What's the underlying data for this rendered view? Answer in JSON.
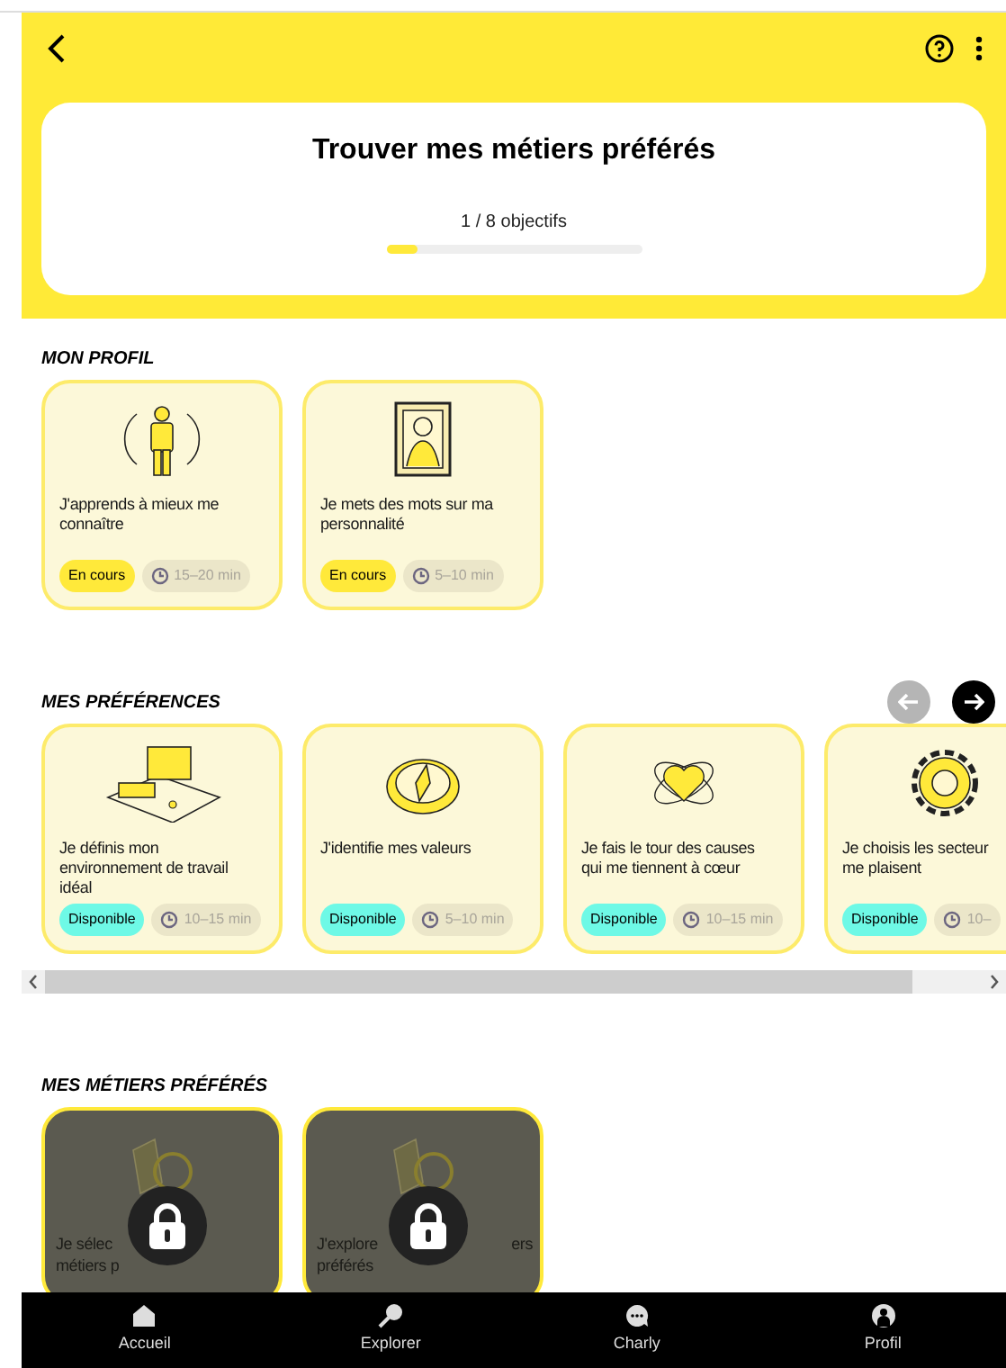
{
  "header": {
    "title": "Trouver mes métiers préférés",
    "progress_text": "1 / 8 objectifs",
    "level": 0.125
  },
  "sections": [
    {
      "title": "MON PROFIL",
      "cards": [
        {
          "kind": "person",
          "lines": [
            "J'apprends à mieux me",
            "connaître"
          ],
          "status": {
            "label": "En cours",
            "kind": "in_progress"
          },
          "duration": "15–20 min",
          "locked": false
        },
        {
          "kind": "portrait",
          "lines": [
            "Je mets des mots sur ma",
            "personnalité"
          ],
          "status": {
            "label": "En cours",
            "kind": "in_progress"
          },
          "duration": "5–10 min",
          "locked": false
        }
      ]
    },
    {
      "title": "MES PRÉFÉRENCES",
      "nav": [
        {
          "kind": "prev",
          "disabled": true
        },
        {
          "kind": "next",
          "disabled": false
        }
      ],
      "scrollbar": true,
      "cards": [
        {
          "kind": "computer",
          "lines": [
            "Je définis mon",
            "environnement de travail",
            "idéal"
          ],
          "status": {
            "label": "Disponible",
            "kind": "available"
          },
          "duration": "10–15 min",
          "locked": false
        },
        {
          "kind": "compass",
          "lines": [
            "J'identifie mes valeurs"
          ],
          "status": {
            "label": "Disponible",
            "kind": "available"
          },
          "duration": "5–10 min",
          "locked": false
        },
        {
          "kind": "heart",
          "lines": [
            "Je fais le tour des causes",
            "qui me tiennent à cœur"
          ],
          "status": {
            "label": "Disponible",
            "kind": "available"
          },
          "duration": "10–15 min",
          "locked": false
        },
        {
          "kind": "gear",
          "lines": [
            "Je choisis les secteur",
            "me plaisent"
          ],
          "status": {
            "label": "Disponible",
            "kind": "available"
          },
          "duration": "10–",
          "locked": false
        }
      ]
    },
    {
      "title": "MES MÉTIERS PRÉFÉRÉS",
      "cards": [
        {
          "kind": "folder",
          "lines": [
            {
              "left": "Je sélec"
            },
            {
              "left": "métiers p"
            }
          ],
          "locked": true
        },
        {
          "kind": "folder",
          "lines": [
            {
              "left": "J'explore",
              "right": "ers"
            },
            {
              "left": "préférés"
            }
          ],
          "locked": true
        }
      ]
    }
  ],
  "bottom_nav": [
    {
      "kind": "home",
      "label": "Accueil"
    },
    {
      "kind": "search",
      "label": "Explorer"
    },
    {
      "kind": "chat",
      "label": "Charly"
    },
    {
      "kind": "profile",
      "label": "Profil"
    }
  ]
}
